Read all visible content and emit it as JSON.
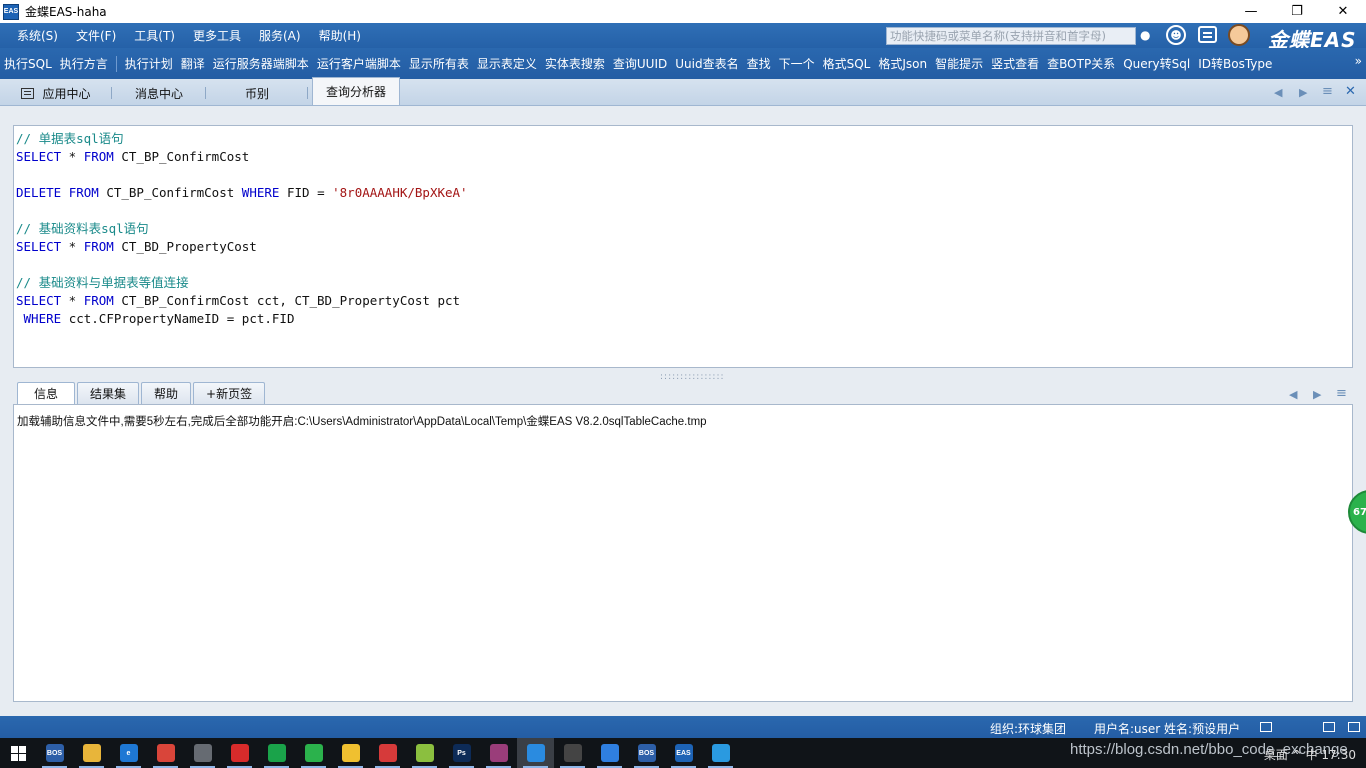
{
  "window": {
    "title": "金蝶EAS-haha",
    "app_icon": "EAS",
    "minimize": "—",
    "restore": "❐",
    "close": "✕"
  },
  "menubar": {
    "items": [
      "系统(S)",
      "文件(F)",
      "工具(T)",
      "更多工具",
      "服务(A)",
      "帮助(H)"
    ],
    "search_placeholder": "功能快捷码或菜单名称(支持拼音和首字母)",
    "brand": "金蝶EAS"
  },
  "toolbar": {
    "group1": [
      "执行SQL",
      "执行方言"
    ],
    "group2": [
      "执行计划",
      "翻译",
      "运行服务器端脚本",
      "运行客户端脚本",
      "显示所有表",
      "显示表定义",
      "实体表搜索",
      "查询UUID",
      "Uuid查表名",
      "查找",
      "下一个",
      "格式SQL",
      "格式Json",
      "智能提示",
      "竖式查看",
      "查BOTP关系",
      "Query转Sql",
      "ID转BosType"
    ],
    "overflow": "»"
  },
  "tabs": [
    {
      "label": "应用中心",
      "icon": "home-icon",
      "active": false
    },
    {
      "label": "消息中心",
      "active": false
    },
    {
      "label": "币别",
      "active": false
    },
    {
      "label": "查询分析器",
      "active": true
    }
  ],
  "editor": {
    "lines": [
      [
        {
          "t": "comment",
          "v": "// 单据表sql语句"
        }
      ],
      [
        {
          "t": "kw",
          "v": "SELECT"
        },
        {
          "t": "plain",
          "v": " * "
        },
        {
          "t": "kw",
          "v": "FROM"
        },
        {
          "t": "plain",
          "v": " CT_BP_ConfirmCost"
        }
      ],
      [],
      [
        {
          "t": "kw",
          "v": "DELETE"
        },
        {
          "t": "plain",
          "v": " "
        },
        {
          "t": "kw",
          "v": "FROM"
        },
        {
          "t": "plain",
          "v": " CT_BP_ConfirmCost "
        },
        {
          "t": "kw",
          "v": "WHERE"
        },
        {
          "t": "plain",
          "v": " FID = "
        },
        {
          "t": "str",
          "v": "'8r0AAAAHK/BpXKeA'"
        }
      ],
      [],
      [
        {
          "t": "comment",
          "v": "// 基础资料表sql语句"
        }
      ],
      [
        {
          "t": "kw",
          "v": "SELECT"
        },
        {
          "t": "plain",
          "v": " * "
        },
        {
          "t": "kw",
          "v": "FROM"
        },
        {
          "t": "plain",
          "v": " CT_BD_PropertyCost"
        }
      ],
      [],
      [
        {
          "t": "comment",
          "v": "// 基础资料与单据表等值连接"
        }
      ],
      [
        {
          "t": "kw",
          "v": "SELECT"
        },
        {
          "t": "plain",
          "v": " * "
        },
        {
          "t": "kw",
          "v": "FROM"
        },
        {
          "t": "plain",
          "v": " CT_BP_ConfirmCost cct, CT_BD_PropertyCost pct"
        }
      ],
      [
        {
          "t": "plain",
          "v": " "
        },
        {
          "t": "kw",
          "v": "WHERE"
        },
        {
          "t": "plain",
          "v": " cct.CFPropertyNameID = pct.FID"
        }
      ]
    ]
  },
  "lower_tabs": [
    {
      "label": "信息",
      "active": true
    },
    {
      "label": "结果集",
      "active": false
    },
    {
      "label": "帮助",
      "active": false
    },
    {
      "label": "+新页签",
      "active": false
    }
  ],
  "info_message": "加载辅助信息文件中,需要5秒左右,完成后全部功能开启:C:\\Users\\Administrator\\AppData\\Local\\Temp\\金蝶EAS V8.2.0sqlTableCache.tmp",
  "badge": "67",
  "statusbar": {
    "org": "组织:环球集团",
    "user": "用户名:user 姓名:预设用户"
  },
  "taskbar": {
    "apps": [
      {
        "name": "bos",
        "label": "BOS",
        "color": "#2d5fa8"
      },
      {
        "name": "folder",
        "label": "",
        "color": "#e8b53a"
      },
      {
        "name": "edge",
        "label": "e",
        "color": "#1e78d4"
      },
      {
        "name": "chrome",
        "label": "",
        "color": "#d9453a"
      },
      {
        "name": "terminal",
        "label": "",
        "color": "#666b72"
      },
      {
        "name": "netease-music",
        "label": "",
        "color": "#d82b2b"
      },
      {
        "name": "green-app",
        "label": "",
        "color": "#1aa34a"
      },
      {
        "name": "wechat",
        "label": "",
        "color": "#2bb24c"
      },
      {
        "name": "qq",
        "label": "",
        "color": "#f0c030"
      },
      {
        "name": "xmind",
        "label": "",
        "color": "#d63a3a"
      },
      {
        "name": "notepad",
        "label": "",
        "color": "#8bbf3f"
      },
      {
        "name": "photoshop",
        "label": "Ps",
        "color": "#0d2b57"
      },
      {
        "name": "winrar",
        "label": "",
        "color": "#9a3d7a"
      },
      {
        "name": "feishu",
        "label": "",
        "color": "#2a8be0"
      },
      {
        "name": "camera",
        "label": "",
        "color": "#444"
      },
      {
        "name": "pen-app",
        "label": "",
        "color": "#2f7fe0"
      },
      {
        "name": "bos2",
        "label": "BOS",
        "color": "#2d5fa8"
      },
      {
        "name": "eas",
        "label": "EAS",
        "color": "#1d63b5"
      },
      {
        "name": "draw-app",
        "label": "",
        "color": "#2a9ae0"
      }
    ],
    "watermark": "https://blog.csdn.net/bbo_code_exchange",
    "tray": "桌面 ^   中   17:30"
  }
}
